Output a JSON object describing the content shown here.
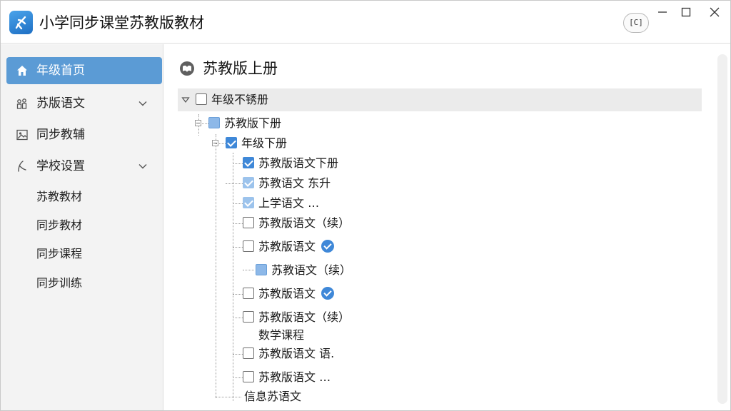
{
  "app": {
    "title": "小学同步课堂苏教版教材"
  },
  "titlebar": {
    "pin_label": "[C]"
  },
  "sidebar": {
    "items": [
      {
        "label": "年级首页",
        "icon": "home-icon",
        "active": true
      },
      {
        "label": "苏版语文",
        "icon": "people-icon",
        "expandable": true
      },
      {
        "label": "同步教辅",
        "icon": "image-icon"
      },
      {
        "label": "学校设置",
        "icon": "feather-icon",
        "expandable": true
      }
    ],
    "subitems": [
      "苏教教材",
      "同步教材",
      "同步课程",
      "同步训练"
    ]
  },
  "main": {
    "title": "苏教版上册",
    "tree": {
      "root": {
        "label": "年级不锈册",
        "checked": false
      },
      "level1": {
        "label": "苏教版下册",
        "state": "partial"
      },
      "level2": {
        "label": "年级下册",
        "state": "checked"
      },
      "rows": [
        {
          "label": "苏教版语文下册",
          "state": "checked"
        },
        {
          "label": "苏教语文 东升",
          "state": "checked-light"
        },
        {
          "label": "上学语文 …",
          "state": "checked-light"
        },
        {
          "label": "苏教版语文（续）",
          "state": "unchecked"
        },
        {
          "label": "苏教版语文",
          "state": "unchecked",
          "badge": true
        },
        {
          "label": "苏教语文（续）",
          "state": "partial"
        },
        {
          "label": "苏教版语文",
          "state": "unchecked",
          "badge": true
        },
        {
          "label": "苏教版语文（续）",
          "state": "unchecked"
        },
        {
          "label": "数学课程",
          "state": "none"
        },
        {
          "label": "苏教版语文 语.",
          "state": "unchecked"
        },
        {
          "label": "苏教版语文 …",
          "state": "unchecked"
        },
        {
          "label": "信息苏语文",
          "state": "none"
        }
      ]
    }
  }
}
